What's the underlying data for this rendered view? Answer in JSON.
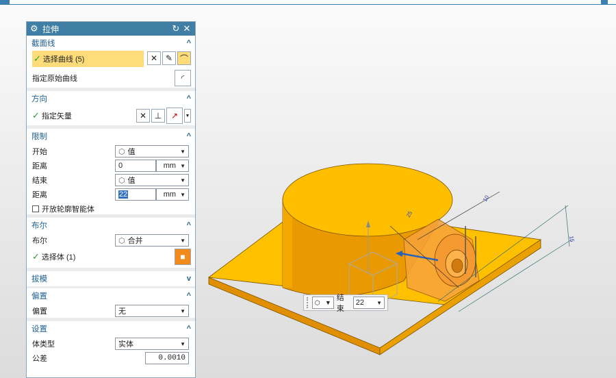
{
  "dialog": {
    "title": "拉伸",
    "sections": {
      "section_curve": {
        "header": "截面线",
        "select_curve": "选择曲线 (5)",
        "specify_curve": "指定原始曲线"
      },
      "direction": {
        "header": "方向",
        "specify_vector": "指定矢量"
      },
      "limits": {
        "header": "限制",
        "start_label": "开始",
        "start_value": "值",
        "distance1_label": "距离",
        "distance1_value": "0",
        "distance1_unit": "mm",
        "end_label": "结束",
        "end_value": "值",
        "distance2_label": "距离",
        "distance2_value": "22",
        "distance2_unit": "mm",
        "open_profile": "开放轮廓智能体"
      },
      "boolean": {
        "header": "布尔",
        "boolean_label": "布尔",
        "boolean_value": "合并",
        "select_body": "选择体 (1)"
      },
      "draft": {
        "header": "拔模"
      },
      "offset": {
        "header": "偏置",
        "offset_label": "偏置",
        "offset_value": "无"
      },
      "settings": {
        "header": "设置",
        "body_type_label": "体类型",
        "body_type_value": "实体",
        "tolerance_label": "公差",
        "tolerance_value": "0.0010"
      }
    }
  },
  "float_toolbar": {
    "end_label": "结束",
    "end_value": "22"
  },
  "dims": {
    "d1": "25",
    "d2": "10",
    "d3": "15"
  },
  "colors": {
    "solid": "#f5b300",
    "solid_dark": "#d88a00",
    "solid_light": "#ffcc33",
    "header_blue": "#3f7fa5"
  }
}
